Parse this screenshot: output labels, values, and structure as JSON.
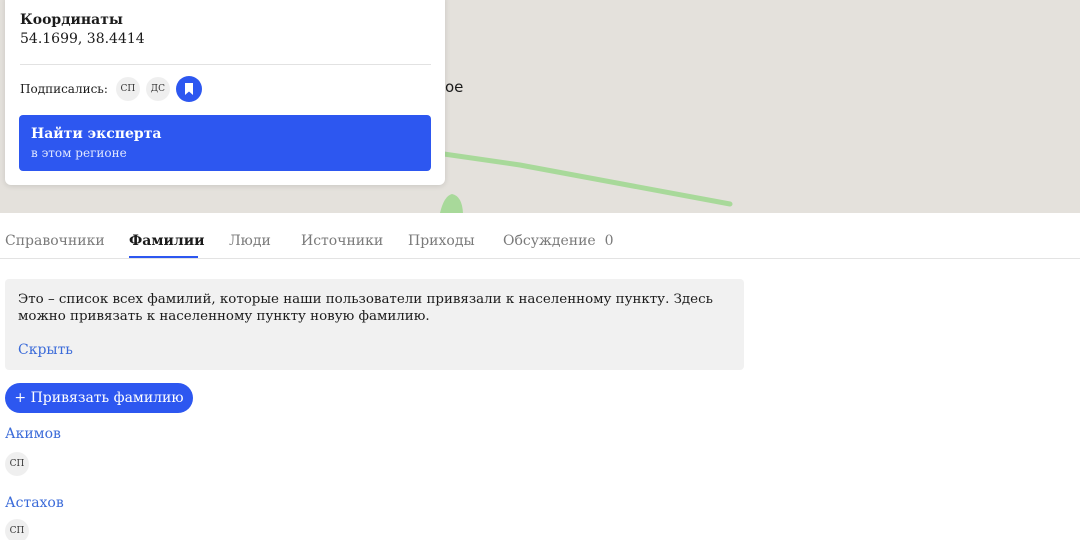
{
  "map": {
    "place_label_fragment": "ое"
  },
  "card": {
    "coord_title": "Координаты",
    "coord_value": "54.1699, 38.4414",
    "subscribers_label": "Подписались:",
    "subscribers": [
      "СП",
      "ДС"
    ],
    "expert_title": "Найти эксперта",
    "expert_subtitle": "в этом регионе"
  },
  "tabs": [
    {
      "label": "Справочники"
    },
    {
      "label": "Фамилии"
    },
    {
      "label": "Люди"
    },
    {
      "label": "Источники"
    },
    {
      "label": "Приходы"
    },
    {
      "label": "Обсуждение  0"
    }
  ],
  "notice": {
    "text": "Это – список всех фамилий, которые наши пользователи привязали к населенному пункту. Здесь можно привязать к населенному пункту новую фамилию.",
    "hide_label": "Скрыть"
  },
  "add_surname_label": "+ Привязать фамилию",
  "surnames": [
    {
      "name": "Акимов",
      "initials": "СП"
    },
    {
      "name": "Астахов",
      "initials": "СП"
    }
  ],
  "colors": {
    "accent": "#2d57f0",
    "link": "#3b6bd9",
    "map_bg": "#e4e1dc",
    "road": "#a8d99a"
  }
}
